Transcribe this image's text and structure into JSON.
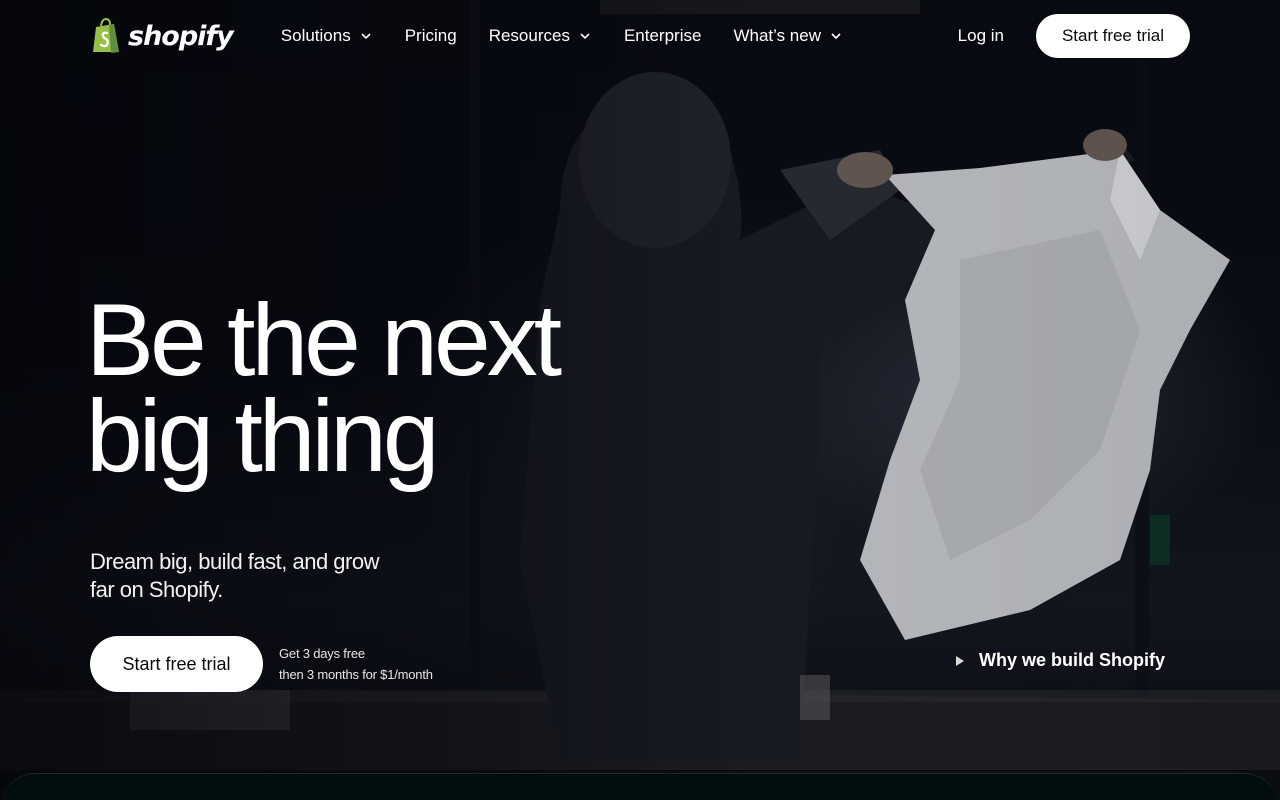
{
  "brand": {
    "name": "shopify",
    "logo_color": "#95bf47"
  },
  "nav": {
    "items": [
      {
        "label": "Solutions",
        "dropdown": true
      },
      {
        "label": "Pricing",
        "dropdown": false
      },
      {
        "label": "Resources",
        "dropdown": true
      },
      {
        "label": "Enterprise",
        "dropdown": false
      },
      {
        "label": "What’s new",
        "dropdown": true
      }
    ],
    "login_label": "Log in",
    "cta_label": "Start free trial"
  },
  "hero": {
    "headline_line1": "Be the next",
    "headline_line2": "big thing",
    "subhead": "Dream big, build fast, and grow far on Shopify.",
    "cta_label": "Start free trial",
    "trial_note_line1": "Get 3 days free",
    "trial_note_line2": "then 3 months for $1/month",
    "video_link_label": "Why we build Shopify"
  },
  "colors": {
    "cta_bg": "#ffffff",
    "cta_text": "#0b0b0b",
    "page_bg": "#05070b"
  }
}
